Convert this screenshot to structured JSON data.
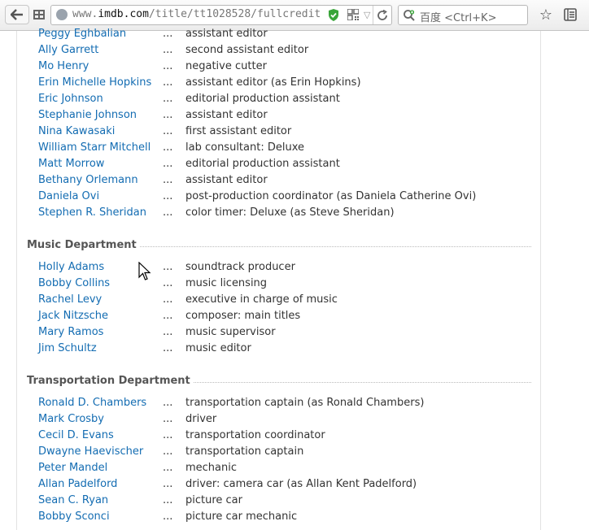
{
  "browser": {
    "url_prefix": "www.",
    "url_domain": "imdb.com",
    "url_path": "/title/tt1028528/fullcredit",
    "search_placeholder": "百度 <Ctrl+K>",
    "icons": {
      "back": "arrow-left-icon",
      "grid": "grid-icon",
      "globe": "globe-icon",
      "shield": "shield-check-icon",
      "qr": "qr-code-icon",
      "dropdown": "chevron-down-icon",
      "reload": "reload-icon",
      "search": "search-icon",
      "bookmark": "star-icon",
      "menu": "reader-menu-icon"
    }
  },
  "colors": {
    "link": "#136cb2",
    "text": "#333333",
    "header": "#555555",
    "shield": "#3aa53a"
  },
  "sections": [
    {
      "title": "",
      "rows": [
        {
          "name": "Peggy Eghbalian",
          "role": "assistant editor"
        },
        {
          "name": "Ally Garrett",
          "role": "second assistant editor"
        },
        {
          "name": "Mo Henry",
          "role": "negative cutter"
        },
        {
          "name": "Erin Michelle Hopkins",
          "role": "assistant editor (as Erin Hopkins)"
        },
        {
          "name": "Eric Johnson",
          "role": "editorial production assistant"
        },
        {
          "name": "Stephanie Johnson",
          "role": "assistant editor"
        },
        {
          "name": "Nina Kawasaki",
          "role": "first assistant editor"
        },
        {
          "name": "William Starr Mitchell",
          "role": "lab consultant: Deluxe"
        },
        {
          "name": "Matt Morrow",
          "role": "editorial production assistant"
        },
        {
          "name": "Bethany Orlemann",
          "role": "assistant editor"
        },
        {
          "name": "Daniela Ovi",
          "role": "post-production coordinator (as Daniela Catherine Ovi)"
        },
        {
          "name": "Stephen R. Sheridan",
          "role": "color timer: Deluxe (as Steve Sheridan)"
        }
      ]
    },
    {
      "title": "Music Department",
      "rows": [
        {
          "name": "Holly Adams",
          "role": "soundtrack producer"
        },
        {
          "name": "Bobby Collins",
          "role": "music licensing"
        },
        {
          "name": "Rachel Levy",
          "role": "executive in charge of music"
        },
        {
          "name": "Jack Nitzsche",
          "role": "composer: main titles"
        },
        {
          "name": "Mary Ramos",
          "role": "music supervisor"
        },
        {
          "name": "Jim Schultz",
          "role": "music editor"
        }
      ]
    },
    {
      "title": "Transportation Department",
      "rows": [
        {
          "name": "Ronald D. Chambers",
          "role": "transportation captain (as Ronald Chambers)"
        },
        {
          "name": "Mark Crosby",
          "role": "driver"
        },
        {
          "name": "Cecil D. Evans",
          "role": "transportation coordinator"
        },
        {
          "name": "Dwayne Haevischer",
          "role": "transportation captain"
        },
        {
          "name": "Peter Mandel",
          "role": "mechanic"
        },
        {
          "name": "Allan Padelford",
          "role": "driver: camera car (as Allan Kent Padelford)"
        },
        {
          "name": "Sean C. Ryan",
          "role": "picture car"
        },
        {
          "name": "Bobby Sconci",
          "role": "picture car mechanic"
        }
      ]
    }
  ],
  "separator": "..."
}
